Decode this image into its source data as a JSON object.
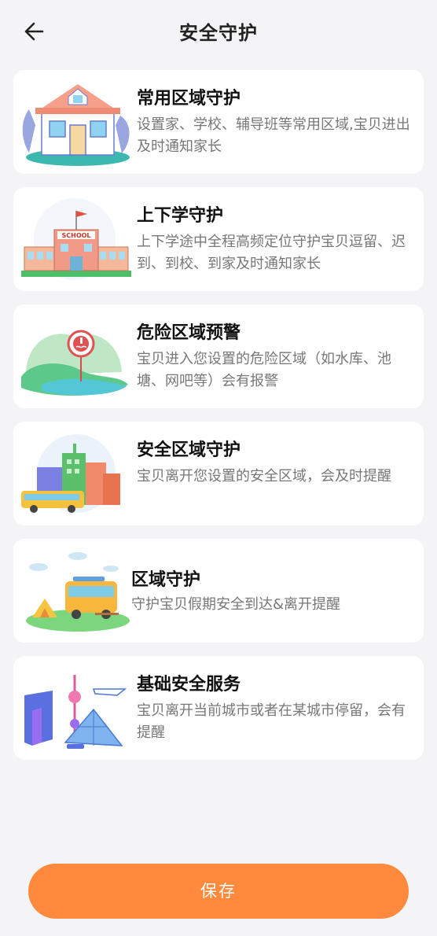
{
  "header": {
    "back_icon": "arrow-left-icon",
    "title": "安全守护"
  },
  "cards": [
    {
      "title": "常用区域守护",
      "desc": "设置家、学校、辅导班等常用区域,宝贝进出及时通知家长",
      "icon": "house-illustration"
    },
    {
      "title": "上下学守护",
      "desc": "上下学途中全程高频定位守护宝贝逗留、迟到、到校、到家及时通知家长",
      "icon": "school-illustration",
      "school_sign": "SCHOOL"
    },
    {
      "title": "危险区域预警",
      "desc": "宝贝进入您设置的危险区域（如水库、池塘、网吧等）会有报警",
      "icon": "danger-water-illustration"
    },
    {
      "title": "安全区域守护",
      "desc": "宝贝离开您设置的安全区域，会及时提醒",
      "icon": "city-bus-illustration"
    },
    {
      "title": "区域守护",
      "desc": "守护宝贝假期安全到达&离开提醒",
      "icon": "camping-van-illustration"
    },
    {
      "title": "基础安全服务",
      "desc": "宝贝离开当前城市或者在某城市停留，会有提醒",
      "icon": "city-landmarks-illustration"
    }
  ],
  "save_button": {
    "label": "保存",
    "color": "#ff8a3d"
  }
}
